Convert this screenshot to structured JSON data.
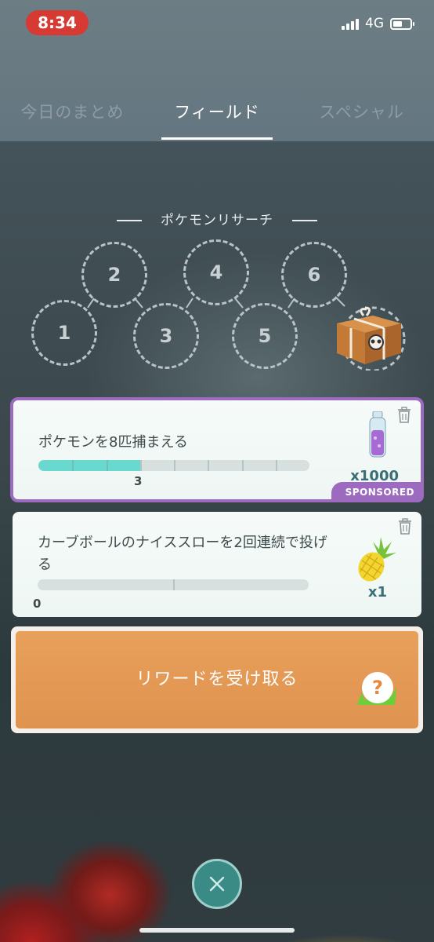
{
  "status_bar": {
    "time": "8:34",
    "network": "4G",
    "battery_level": 0.55
  },
  "tabs": [
    {
      "label": "今日のまとめ",
      "active": false
    },
    {
      "label": "フィールド",
      "active": true
    },
    {
      "label": "スペシャル",
      "active": false
    }
  ],
  "research": {
    "title": "ポケモンリサーチ",
    "steps": [
      "1",
      "2",
      "3",
      "4",
      "5",
      "6"
    ]
  },
  "tasks": [
    {
      "text": "ポケモンを8匹捕まえる",
      "progress": 3,
      "goal": 8,
      "count_label": "3",
      "reward_quantity": "x1000",
      "reward_icon": "potion-icon",
      "sponsored_label": "SPONSORED"
    },
    {
      "text": "カーブボールのナイススローを2回連続で投げる",
      "progress": 0,
      "goal": 2,
      "count_label": "0",
      "reward_quantity": "x1",
      "reward_icon": "pinap-berry-icon"
    }
  ],
  "reward_button": {
    "label": "リワードを受け取る"
  },
  "colors": {
    "accent_teal": "#69d9cf",
    "sponsored_purple": "#9c6bc0",
    "reward_orange": "#e29a55",
    "clock_red": "#d63a33"
  }
}
